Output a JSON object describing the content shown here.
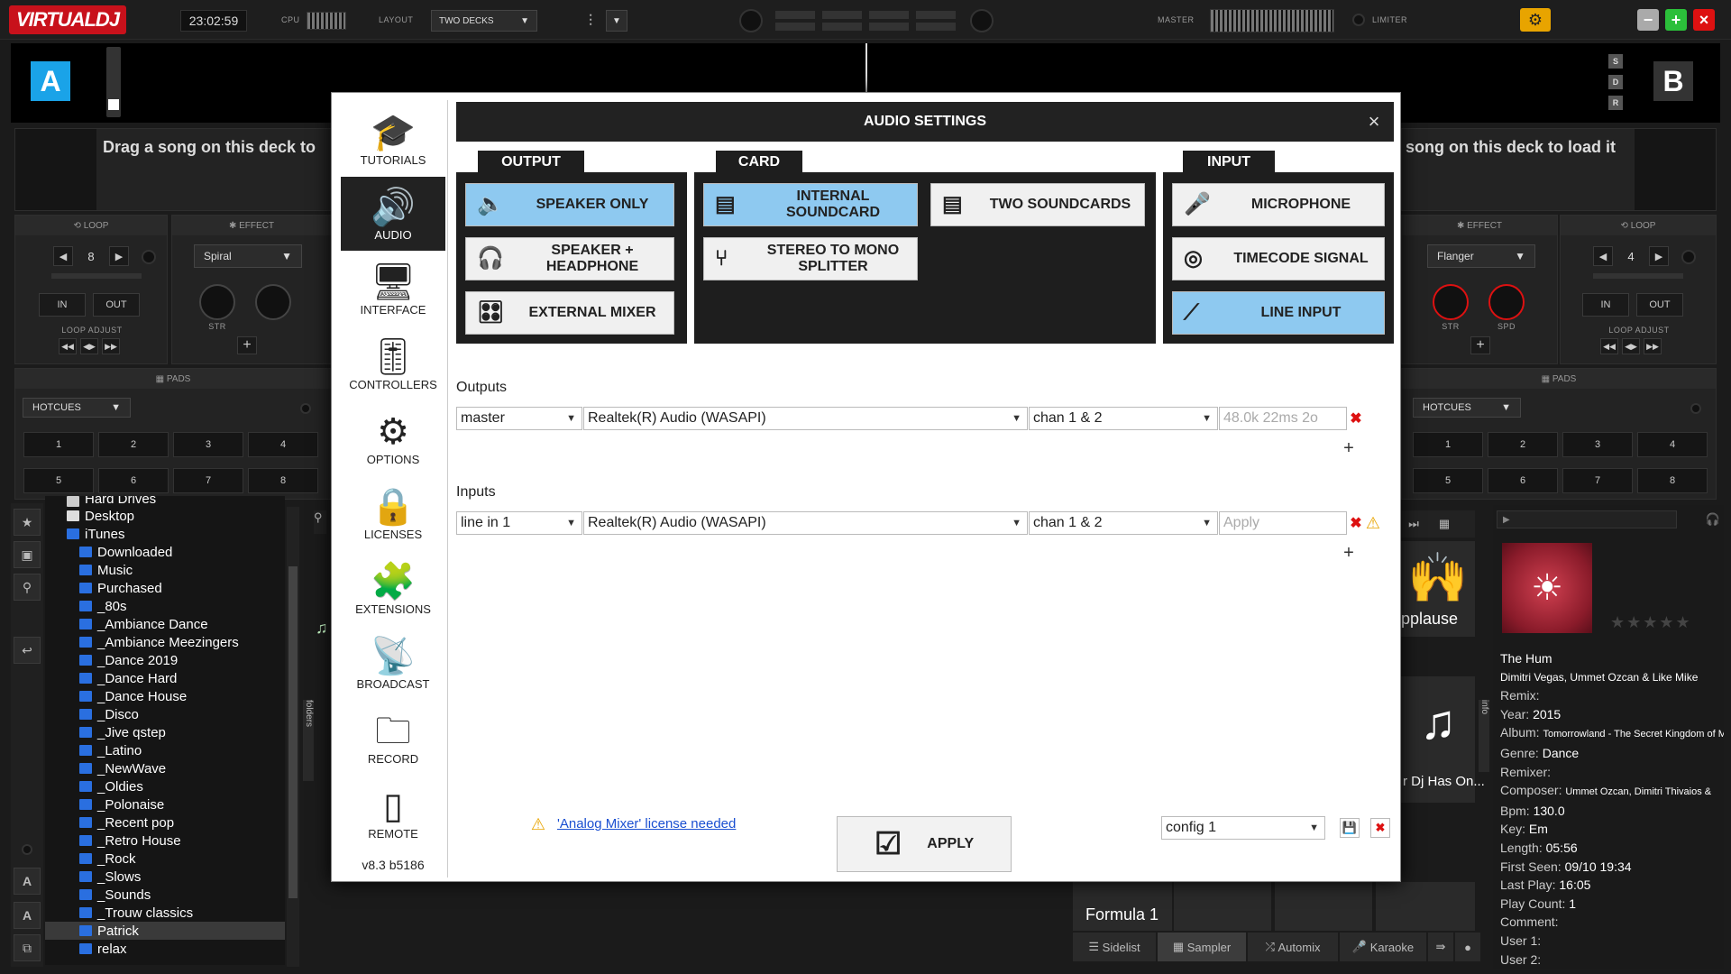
{
  "topbar": {
    "logo": "VIRTUALDJ",
    "clock": "23:02:59",
    "cpu_label": "CPU",
    "layout_label": "LAYOUT",
    "layout_value": "TWO DECKS",
    "master_label": "MASTER",
    "limiter_label": "LIMITER"
  },
  "deck_a": {
    "letter": "A",
    "drop_text": "Drag a song on this deck to",
    "loop_label": "LOOP",
    "loop_value": "8",
    "in": "IN",
    "out": "OUT",
    "loop_adjust": "LOOP ADJUST",
    "effect_label": "EFFECT",
    "effect_value": "Spiral",
    "str": "STR",
    "pads_label": "PADS",
    "pad_mode": "HOTCUES",
    "pads": [
      "1",
      "2",
      "3",
      "4",
      "5",
      "6",
      "7",
      "8"
    ]
  },
  "deck_b": {
    "letter": "B",
    "drop_text": "song on this deck to load it",
    "loop_label": "LOOP",
    "loop_value": "4",
    "in": "IN",
    "out": "OUT",
    "loop_adjust": "LOOP ADJUST",
    "effect_label": "EFFECT",
    "effect_value": "Flanger",
    "str": "STR",
    "spd": "SPD",
    "pads_label": "PADS",
    "pad_mode": "HOTCUES",
    "pads": [
      "1",
      "2",
      "3",
      "4",
      "5",
      "6",
      "7",
      "8"
    ],
    "sdr": [
      "S",
      "D",
      "R"
    ]
  },
  "browser": {
    "items": [
      "Hard Drives",
      "Desktop",
      "iTunes",
      "Downloaded",
      "Music",
      "Purchased",
      "_80s",
      "_Ambiance Dance",
      "_Ambiance Meezingers",
      "_Dance 2019",
      "_Dance Hard",
      "_Dance House",
      "_Disco",
      "_Jive qstep",
      "_Latino",
      "_NewWave",
      "_Oldies",
      "_Polonaise",
      "_Recent pop",
      "_Retro House",
      "_Rock",
      "_Slows",
      "_Sounds",
      "_Trouw classics",
      "Patrick",
      "relax"
    ],
    "folders_tab": "folders",
    "info_tab": "info"
  },
  "sampler": {
    "applause": "pplause",
    "djhas": "r Dj Has On...",
    "formula": "Formula 1"
  },
  "bottom_tabs": [
    "Sidelist",
    "Sampler",
    "Automix",
    "Karaoke"
  ],
  "track": {
    "title": "The Hum",
    "artist": "Dimitri Vegas, Ummet Ozcan & Like Mike",
    "remix_l": "Remix:",
    "year_l": "Year:",
    "year": "2015",
    "album_l": "Album:",
    "album": "Tomorrowland - The Secret Kingdom of M",
    "genre_l": "Genre:",
    "genre": "Dance",
    "remixer_l": "Remixer:",
    "composer_l": "Composer:",
    "composer": "Ummet Ozcan, Dimitri Thivaios &",
    "bpm_l": "Bpm:",
    "bpm": "130.0",
    "key_l": "Key:",
    "key": "Em",
    "length_l": "Length:",
    "length": "05:56",
    "first_l": "First Seen:",
    "first": "09/10 19:34",
    "last_l": "Last Play:",
    "last": "16:05",
    "count_l": "Play Count:",
    "count": "1",
    "comment_l": "Comment:",
    "user1_l": "User 1:",
    "user2_l": "User 2:",
    "rating": "★★★★★"
  },
  "dialog": {
    "title": "AUDIO SETTINGS",
    "nav": [
      "TUTORIALS",
      "AUDIO",
      "INTERFACE",
      "CONTROLLERS",
      "OPTIONS",
      "LICENSES",
      "EXTENSIONS",
      "BROADCAST",
      "RECORD",
      "REMOTE"
    ],
    "version": "v8.3 b5186",
    "output_title": "OUTPUT",
    "card_title": "CARD",
    "input_title": "INPUT",
    "output_btns": [
      "SPEAKER ONLY",
      "SPEAKER + HEADPHONE",
      "EXTERNAL MIXER"
    ],
    "card_btns": [
      "INTERNAL SOUNDCARD",
      "TWO SOUNDCARDS",
      "STEREO TO MONO SPLITTER"
    ],
    "input_btns": [
      "MICROPHONE",
      "TIMECODE SIGNAL",
      "LINE INPUT"
    ],
    "outputs_label": "Outputs",
    "out_row": {
      "channel": "master",
      "device": "Realtek(R) Audio (WASAPI)",
      "chan": "chan 1 & 2",
      "info": "48.0k 22ms 2o"
    },
    "inputs_label": "Inputs",
    "in_row": {
      "channel": "line in 1",
      "device": "Realtek(R) Audio (WASAPI)",
      "chan": "chan 1 & 2",
      "info": "Apply"
    },
    "license_warning": "'Analog Mixer' license needed",
    "apply": "APPLY",
    "config": "config 1"
  }
}
